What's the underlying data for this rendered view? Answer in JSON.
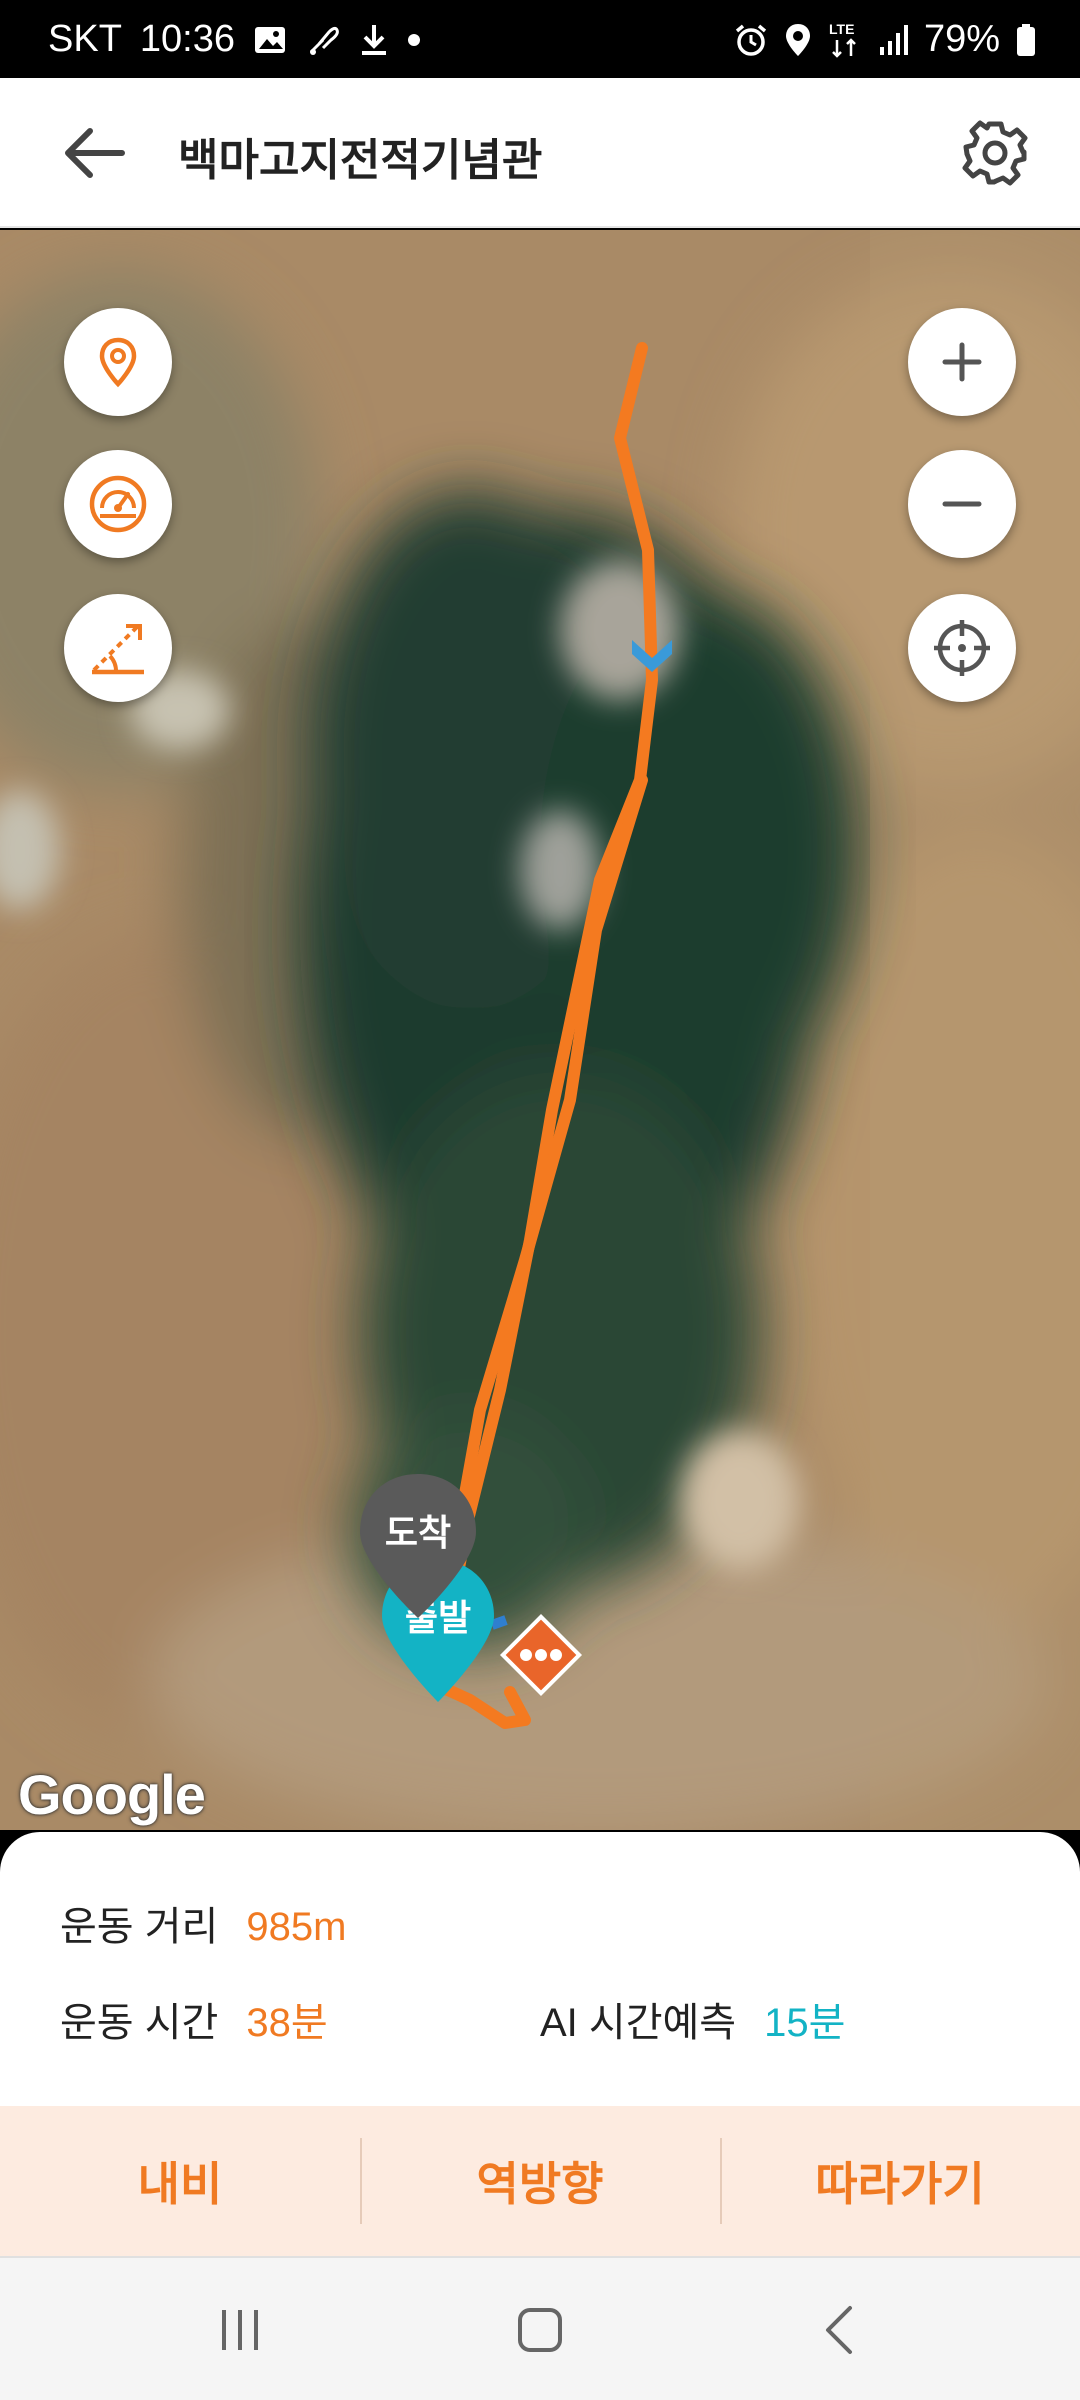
{
  "status_bar": {
    "carrier": "SKT",
    "time": "10:36",
    "network": "LTE",
    "battery": "79%",
    "icons_left": [
      "gallery-icon",
      "fitness-icon",
      "download-icon",
      "dot-icon"
    ],
    "icons_right": [
      "alarm-icon",
      "location-icon",
      "lte-icon",
      "signal-icon",
      "battery-icon"
    ]
  },
  "header": {
    "title": "백마고지전적기념관"
  },
  "map": {
    "arrival_label": "도착",
    "departure_label": "출발",
    "attribution": "Google",
    "route_color": "#f47a20",
    "left_controls": [
      "pin-icon",
      "speedometer-icon",
      "slope-icon"
    ],
    "right_controls": [
      "zoom-in-icon",
      "zoom-out-icon",
      "crosshair-icon"
    ]
  },
  "info": {
    "distance_label": "운동 거리",
    "distance_value": "985m",
    "time_label": "운동 시간",
    "time_value": "38분",
    "ai_label": "AI 시간예측",
    "ai_value": "15분"
  },
  "actions": {
    "nav": "내비",
    "reverse": "역방향",
    "follow": "따라가기"
  },
  "colors": {
    "accent": "#f07a22",
    "teal": "#13b3c5",
    "action_bg": "#fdebe0"
  }
}
